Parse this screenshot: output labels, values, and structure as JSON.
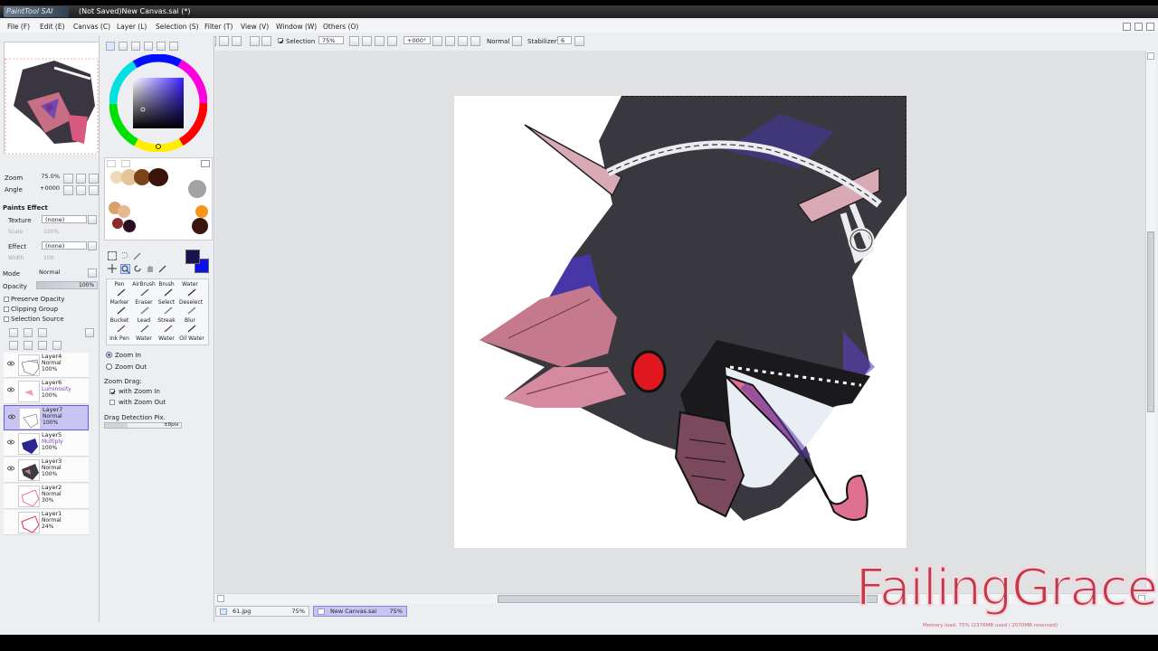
{
  "window": {
    "logo": "PaintTool SAI",
    "title": "(Not Saved)New Canvas.sai (*)"
  },
  "menu": [
    "File (F)",
    "Edit (E)",
    "Canvas (C)",
    "Layer (L)",
    "Selection (S)",
    "Filter (T)",
    "View (V)",
    "Window (W)",
    "Others (O)"
  ],
  "toolbar": {
    "selection_label": "Selection",
    "zoom_value": "75%",
    "angle_value": "+000°",
    "mode_value": "Normal",
    "stabilizer_label": "Stabilizer",
    "stabilizer_value": "6"
  },
  "navigator": {
    "zoom_label": "Zoom",
    "zoom_value": "75.0%",
    "angle_label": "Angle",
    "angle_value": "+0000"
  },
  "paint_effect": {
    "header": "Paints Effect",
    "texture_label": "Texture",
    "texture_value": "(none)",
    "scale_label": "Scale",
    "scale_value": "100%",
    "effect_label": "Effect",
    "effect_value": "(none)",
    "width_label": "Width",
    "width_value": "100"
  },
  "layer_props": {
    "mode_label": "Mode",
    "mode_value": "Normal",
    "opacity_label": "Opacity",
    "opacity_value": "100%",
    "preserve_opacity": "Preserve Opacity",
    "clipping_group": "Clipping Group",
    "selection_source": "Selection Source"
  },
  "layers": [
    {
      "name": "Layer4",
      "mode": "Normal",
      "opacity": "100%",
      "visible": true,
      "selected": false,
      "mode_color": "#222"
    },
    {
      "name": "Layer6",
      "mode": "Luminosity",
      "opacity": "100%",
      "visible": true,
      "selected": false,
      "mode_color": "#7d3fb8"
    },
    {
      "name": "Layer7",
      "mode": "Normal",
      "opacity": "100%",
      "visible": true,
      "selected": true,
      "mode_color": "#222"
    },
    {
      "name": "Layer5",
      "mode": "Multiply",
      "opacity": "100%",
      "visible": true,
      "selected": false,
      "mode_color": "#7d3fb8"
    },
    {
      "name": "Layer3",
      "mode": "Normal",
      "opacity": "100%",
      "visible": true,
      "selected": false,
      "mode_color": "#222"
    },
    {
      "name": "Layer2",
      "mode": "Normal",
      "opacity": "30%",
      "visible": false,
      "selected": false,
      "mode_color": "#222"
    },
    {
      "name": "Layer1",
      "mode": "Normal",
      "opacity": "24%",
      "visible": false,
      "selected": false,
      "mode_color": "#222"
    }
  ],
  "tools": [
    [
      "Pen",
      "AirBrush",
      "Brush",
      "Water"
    ],
    [
      "Marker",
      "Eraser",
      "Select",
      "Deselect"
    ],
    [
      "Bucket",
      "Lead",
      "Streak",
      "Blur"
    ],
    [
      "Ink Pen",
      "Water",
      "Water",
      "Oil Water"
    ]
  ],
  "zoom_options": {
    "zoom_in": "Zoom In",
    "zoom_out": "Zoom Out",
    "drag_label": "Zoom Drag:",
    "with_zoom_in": "with Zoom In",
    "with_zoom_out": "with Zoom Out",
    "drag_detection": "Drag Detection Pix.",
    "drag_value": "±8pix"
  },
  "tabs": [
    {
      "name": "61.jpg",
      "zoom": "75%"
    },
    {
      "name": "New Canvas.sai",
      "zoom": "75%"
    }
  ],
  "status": "Memory load: 75% (2376MB used / 2070MB reserved)",
  "watermark": "FailingGrace",
  "colors": {
    "current_fg": "#1b1350",
    "current_bg": "#0a12e8",
    "swatches": [
      "#f0d9b8",
      "#c48c55",
      "#6b3a18",
      "#3b1408",
      "#a0a0a0",
      "#f7951b",
      "#d9a26c",
      "#e0b890",
      "#8c2b2b",
      "#2a1020",
      "#3a160c"
    ]
  }
}
